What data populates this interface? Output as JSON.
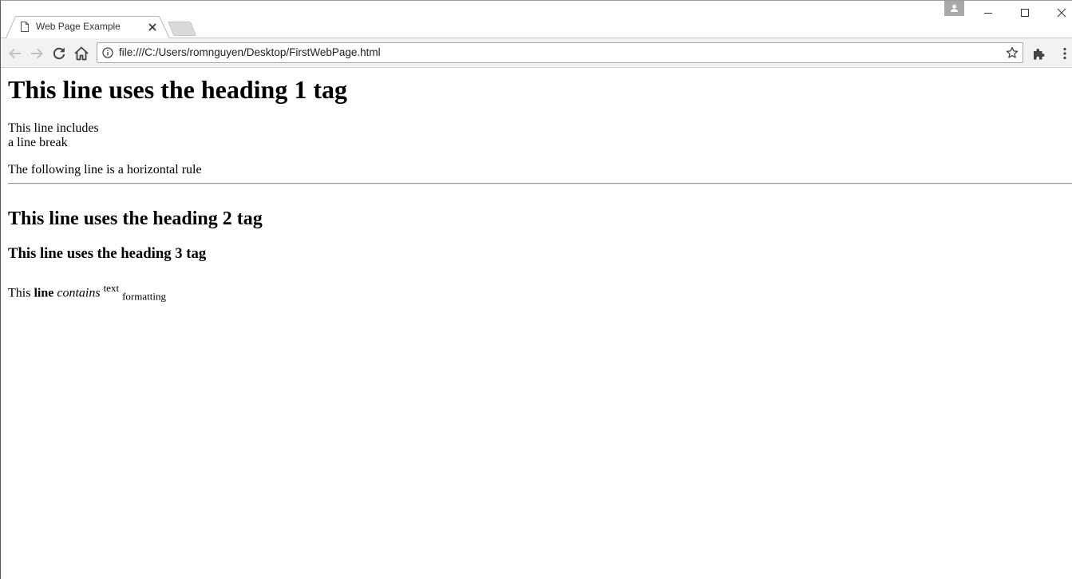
{
  "window": {
    "tab_title": "Web Page Example",
    "url": "file:///C:/Users/romnguyen/Desktop/FirstWebPage.html",
    "icons": {
      "favicon": "page-icon",
      "tab_close": "close-icon",
      "profile": "person-icon",
      "minimize": "minimize-icon",
      "maximize": "maximize-icon",
      "close": "close-icon",
      "back": "arrow-left-icon",
      "forward": "arrow-right-icon",
      "reload": "reload-icon",
      "home": "home-icon",
      "info": "info-icon",
      "bookmark": "star-icon",
      "extensions": "puzzle-icon",
      "menu": "more-vert-icon"
    },
    "colors": {
      "toolbar_bg": "#f2f2f2",
      "profile_bg": "#a9a9a9",
      "rule": "#9a9a9a"
    }
  },
  "content": {
    "heading1": "This line uses the heading 1 tag",
    "line_break_part1": "This line includes",
    "line_break_part2": "a line break",
    "hr_intro": "The following line is a horizontal rule",
    "heading2": "This line uses the heading 2 tag",
    "heading3": "This line uses the heading 3 tag",
    "formatting": {
      "plain": "This ",
      "bold": "line",
      "italic": "contains",
      "superscript": "text",
      "subscript": "formatting"
    }
  }
}
